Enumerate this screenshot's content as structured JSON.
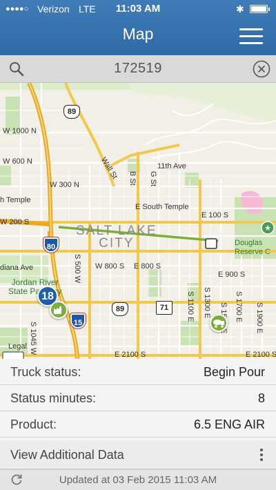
{
  "status_bar": {
    "carrier": "Verizon",
    "network": "LTE",
    "time": "11:03 AM",
    "battery_level": 1.0
  },
  "nav": {
    "title": "Map"
  },
  "search": {
    "value": "172519"
  },
  "map": {
    "labels": {
      "w1000n": "W 1000 N",
      "w600n": "W 600 N",
      "w300n": "W 300 N",
      "temple": "h Temple",
      "w200s": "W 200 S",
      "wall": "Wall St",
      "bst": "B St",
      "gst": "G St",
      "ave11": "11th Ave",
      "esouth": "E South Temple",
      "e100s": "E 100 S",
      "city": "SALT LAKE\nCITY",
      "s500w": "S 500 W",
      "w800s": "W 800 S",
      "e800s": "E 800 S",
      "e900s": "E 900 S",
      "diana": "diana Ave",
      "jordan": "Jordan River\nState Parkway",
      "douglas": "Douglas\nReserve C",
      "s1100e": "S 1100 E",
      "s1300e": "S 1300 E",
      "s1500e": "S 1500 E",
      "s1700e": "S 1700 E",
      "s1900e": "S 1900 E",
      "e2100s": "E 2100 S",
      "e2100s2": "E 2100 S",
      "legal": "Legal",
      "s1045w": "S 1045 W"
    },
    "shields": {
      "i80": "80",
      "i15": "15",
      "us89_top": "89",
      "us89_bottom": "89",
      "ut71": "71"
    },
    "plant_badge": "18",
    "colors": {
      "route": "#7ab03a",
      "highway": "#f2c94c",
      "marker_blue": "#1f5ea8"
    }
  },
  "details": {
    "truck_status_label": "Truck status:",
    "truck_status_value": "Begin Pour",
    "status_minutes_label": "Status minutes:",
    "status_minutes_value": "8",
    "product_label": "Product:",
    "product_value": "6.5 ENG AIR",
    "additional_label": "View Additional Data"
  },
  "footer": {
    "updated": "Updated at 03 Feb 2015 11:03 AM"
  }
}
